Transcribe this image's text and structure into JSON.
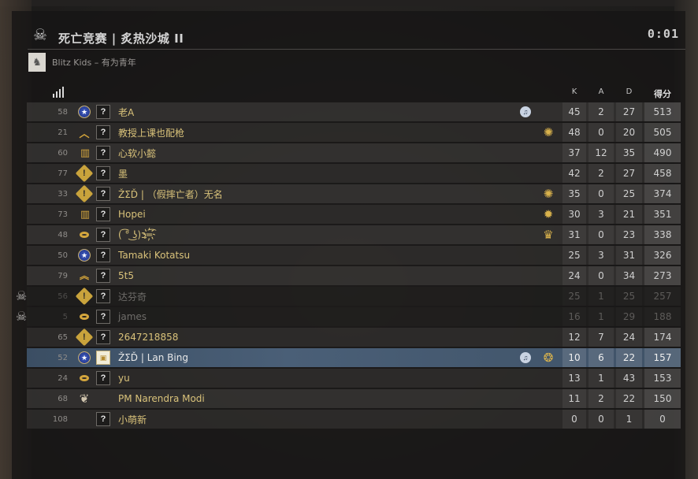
{
  "header": {
    "title": "死亡竞赛 | 炙热沙城 II",
    "timer": "0:01"
  },
  "team": {
    "name": "Blitz Kids – 有为青年"
  },
  "columns": {
    "k": "K",
    "a": "A",
    "d": "D",
    "score": "得分"
  },
  "colors": {
    "accent_gold": "#d9c27a",
    "self_highlight": "#4a5f77",
    "dead_text": "#6f6d6a"
  },
  "players": [
    {
      "ping": "58",
      "rank_icon": "rank-globe-icon",
      "avatar": "?",
      "name": "老A",
      "music": true,
      "coin": "",
      "k": "45",
      "a": "2",
      "d": "27",
      "score": "513"
    },
    {
      "ping": "21",
      "rank_icon": "rank-chevron-icon",
      "avatar": "?",
      "name": "教授上课也配枪",
      "music": false,
      "coin": "service-medal-icon",
      "k": "48",
      "a": "0",
      "d": "20",
      "score": "505"
    },
    {
      "ping": "60",
      "rank_icon": "rank-bars-icon",
      "avatar": "?",
      "name": "心软小懿",
      "music": false,
      "coin": "",
      "k": "37",
      "a": "12",
      "d": "35",
      "score": "490"
    },
    {
      "ping": "77",
      "rank_icon": "rank-warning-icon",
      "avatar": "?",
      "name": "墨",
      "music": false,
      "coin": "",
      "k": "42",
      "a": "2",
      "d": "27",
      "score": "458"
    },
    {
      "ping": "33",
      "rank_icon": "rank-warning-icon",
      "avatar": "?",
      "name": "ŽƩĎ | （假摔亡者）无名",
      "music": false,
      "coin": "service-medal-icon",
      "k": "35",
      "a": "0",
      "d": "25",
      "score": "374"
    },
    {
      "ping": "73",
      "rank_icon": "rank-bars-icon",
      "avatar": "?",
      "name": "Hopei",
      "music": false,
      "coin": "globe-coin-icon",
      "k": "30",
      "a": "3",
      "d": "21",
      "score": "351"
    },
    {
      "ping": "48",
      "rank_icon": "rank-ring-icon",
      "avatar": "?",
      "name": "( ͡° ͜ʖ)ↄ═͡҉",
      "music": false,
      "coin": "crown-coin-icon",
      "k": "31",
      "a": "0",
      "d": "23",
      "score": "338"
    },
    {
      "ping": "50",
      "rank_icon": "rank-globe-icon",
      "avatar": "?",
      "name": "Tamaki Kotatsu",
      "music": false,
      "coin": "",
      "k": "25",
      "a": "3",
      "d": "31",
      "score": "326"
    },
    {
      "ping": "79",
      "rank_icon": "rank-double-chevron-icon",
      "avatar": "?",
      "name": "5t5",
      "music": false,
      "coin": "",
      "k": "24",
      "a": "0",
      "d": "34",
      "score": "273"
    },
    {
      "ping": "56",
      "rank_icon": "rank-warning-icon",
      "avatar": "?",
      "name": "达芬奇",
      "music": false,
      "coin": "",
      "dead": true,
      "k": "25",
      "a": "1",
      "d": "25",
      "score": "257"
    },
    {
      "ping": "5",
      "rank_icon": "rank-ring-icon",
      "avatar": "?",
      "name": "james",
      "music": false,
      "coin": "",
      "dead": true,
      "k": "16",
      "a": "1",
      "d": "29",
      "score": "188"
    },
    {
      "ping": "65",
      "rank_icon": "rank-warning-icon",
      "avatar": "?",
      "name": "2647218858",
      "music": false,
      "coin": "",
      "k": "12",
      "a": "7",
      "d": "24",
      "score": "174"
    },
    {
      "ping": "52",
      "rank_icon": "rank-globe-icon",
      "avatar": "img",
      "name": "ŽƩĎ | Lan Bing",
      "music": true,
      "coin": "dragon-coin-icon",
      "self": true,
      "k": "10",
      "a": "6",
      "d": "22",
      "score": "157"
    },
    {
      "ping": "24",
      "rank_icon": "rank-ring-icon",
      "avatar": "?",
      "name": "yu",
      "music": false,
      "coin": "",
      "k": "13",
      "a": "1",
      "d": "43",
      "score": "153"
    },
    {
      "ping": "68",
      "rank_icon": "rank-wings-icon",
      "avatar": "",
      "name": "PM Narendra Modi",
      "music": false,
      "coin": "",
      "k": "11",
      "a": "2",
      "d": "22",
      "score": "150"
    },
    {
      "ping": "108",
      "rank_icon": "",
      "avatar": "?",
      "name": "小萌新",
      "music": false,
      "coin": "",
      "k": "0",
      "a": "0",
      "d": "1",
      "score": "0"
    }
  ]
}
